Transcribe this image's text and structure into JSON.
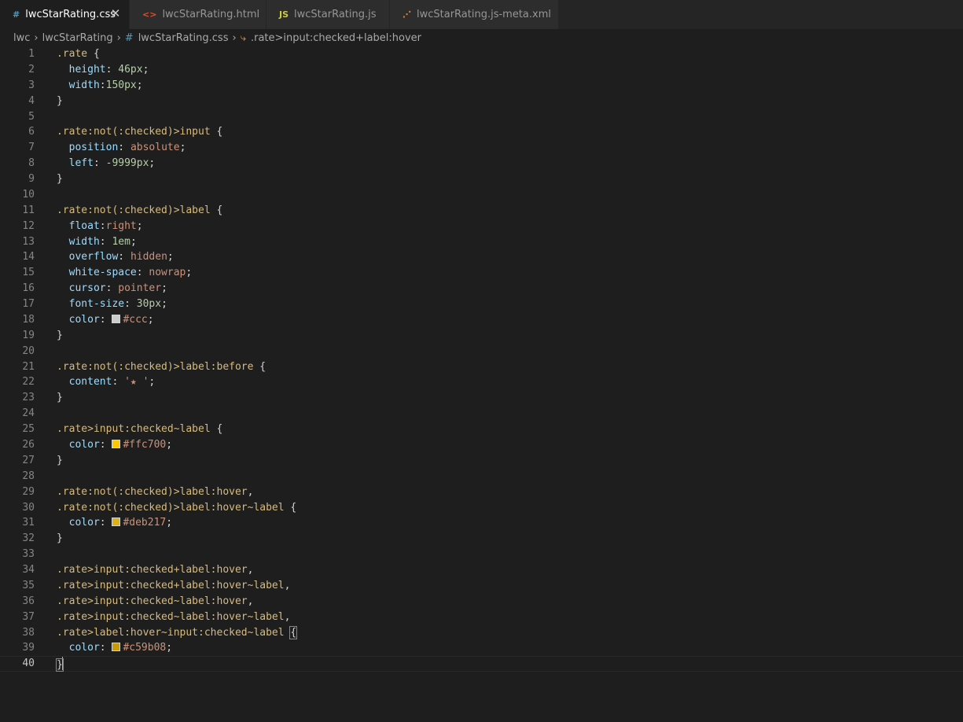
{
  "colors": {
    "selector": "#d7ba7d",
    "property": "#9cdcfe",
    "value": "#ce9178",
    "number": "#b5cea8",
    "punct": "#d4d4d4"
  },
  "tabs": [
    {
      "label": "lwcStarRating.css",
      "icon": "css-hash-icon",
      "glyph": "#",
      "color": "#519aba",
      "active": true,
      "close": "✕"
    },
    {
      "label": "lwcStarRating.html",
      "icon": "html-brackets-icon",
      "glyph": "<>",
      "color": "#e44d26",
      "active": false
    },
    {
      "label": "lwcStarRating.js",
      "icon": "js-icon",
      "glyph": "JS",
      "color": "#cbcb41",
      "active": false
    },
    {
      "label": "lwcStarRating.js-meta.xml",
      "icon": "xml-rss-icon",
      "glyph": "⋰",
      "color": "#e37933",
      "active": false
    }
  ],
  "breadcrumb": {
    "items": [
      "lwc",
      "lwcStarRating",
      "lwcStarRating.css",
      ".rate>input:checked+label:hover"
    ],
    "icons": [
      "",
      "",
      "css-hash-icon",
      "selector-symbol-icon"
    ],
    "glyphs": [
      "",
      "",
      "#",
      "⤷"
    ],
    "separator": "›"
  },
  "editor": {
    "current_line": 40,
    "lines": [
      [
        [
          ".rate",
          "s"
        ],
        [
          " {",
          "p"
        ]
      ],
      [
        [
          "  height",
          "k"
        ],
        [
          ": ",
          "p"
        ],
        [
          "46px",
          "n"
        ],
        [
          ";",
          "p"
        ]
      ],
      [
        [
          "  width",
          "k"
        ],
        [
          ":",
          "p"
        ],
        [
          "150px",
          "n"
        ],
        [
          ";",
          "p"
        ]
      ],
      [
        [
          "}",
          "p"
        ]
      ],
      [],
      [
        [
          ".rate:not(:checked)>input",
          "s"
        ],
        [
          " {",
          "p"
        ]
      ],
      [
        [
          "  position",
          "k"
        ],
        [
          ": ",
          "p"
        ],
        [
          "absolute",
          "v"
        ],
        [
          ";",
          "p"
        ]
      ],
      [
        [
          "  left",
          "k"
        ],
        [
          ": ",
          "p"
        ],
        [
          "-9999px",
          "n"
        ],
        [
          ";",
          "p"
        ]
      ],
      [
        [
          "}",
          "p"
        ]
      ],
      [],
      [
        [
          ".rate:not(:checked)>label",
          "s"
        ],
        [
          " {",
          "p"
        ]
      ],
      [
        [
          "  float",
          "k"
        ],
        [
          ":",
          "p"
        ],
        [
          "right",
          "v"
        ],
        [
          ";",
          "p"
        ]
      ],
      [
        [
          "  width",
          "k"
        ],
        [
          ": ",
          "p"
        ],
        [
          "1em",
          "n"
        ],
        [
          ";",
          "p"
        ]
      ],
      [
        [
          "  overflow",
          "k"
        ],
        [
          ": ",
          "p"
        ],
        [
          "hidden",
          "v"
        ],
        [
          ";",
          "p"
        ]
      ],
      [
        [
          "  white-space",
          "k"
        ],
        [
          ": ",
          "p"
        ],
        [
          "nowrap",
          "v"
        ],
        [
          ";",
          "p"
        ]
      ],
      [
        [
          "  cursor",
          "k"
        ],
        [
          ": ",
          "p"
        ],
        [
          "pointer",
          "v"
        ],
        [
          ";",
          "p"
        ]
      ],
      [
        [
          "  font-size",
          "k"
        ],
        [
          ": ",
          "p"
        ],
        [
          "30px",
          "n"
        ],
        [
          ";",
          "p"
        ]
      ],
      [
        [
          "  color",
          "k"
        ],
        [
          ": ",
          "p"
        ],
        [
          "#cccccc",
          "sw"
        ],
        [
          "#ccc",
          "v"
        ],
        [
          ";",
          "p"
        ]
      ],
      [
        [
          "}",
          "p"
        ]
      ],
      [],
      [
        [
          ".rate:not(:checked)>label:before",
          "s"
        ],
        [
          " {",
          "p"
        ]
      ],
      [
        [
          "  content",
          "k"
        ],
        [
          ": ",
          "p"
        ],
        [
          "'★ '",
          "v"
        ],
        [
          ";",
          "p"
        ]
      ],
      [
        [
          "}",
          "p"
        ]
      ],
      [],
      [
        [
          ".rate>input:checked~label",
          "s"
        ],
        [
          " {",
          "p"
        ]
      ],
      [
        [
          "  color",
          "k"
        ],
        [
          ": ",
          "p"
        ],
        [
          "#ffc700",
          "sw"
        ],
        [
          "#ffc700",
          "v"
        ],
        [
          ";",
          "p"
        ]
      ],
      [
        [
          "}",
          "p"
        ]
      ],
      [],
      [
        [
          ".rate:not(:checked)>label:hover",
          "s"
        ],
        [
          ",",
          "p"
        ]
      ],
      [
        [
          ".rate:not(:checked)>label:hover~label",
          "s"
        ],
        [
          " {",
          "p"
        ]
      ],
      [
        [
          "  color",
          "k"
        ],
        [
          ": ",
          "p"
        ],
        [
          "#deb217",
          "sw"
        ],
        [
          "#deb217",
          "v"
        ],
        [
          ";",
          "p"
        ]
      ],
      [
        [
          "}",
          "p"
        ]
      ],
      [],
      [
        [
          ".rate>input:checked+label:hover",
          "s"
        ],
        [
          ",",
          "p"
        ]
      ],
      [
        [
          ".rate>input:checked+label:hover~label",
          "s"
        ],
        [
          ",",
          "p"
        ]
      ],
      [
        [
          ".rate>input:checked~label:hover",
          "s"
        ],
        [
          ",",
          "p"
        ]
      ],
      [
        [
          ".rate>input:checked~label:hover~label",
          "s"
        ],
        [
          ",",
          "p"
        ]
      ],
      [
        [
          ".rate>label:hover~input:checked~label",
          "s"
        ],
        [
          " ",
          "p"
        ],
        [
          "{",
          "bp"
        ]
      ],
      [
        [
          "  color",
          "k"
        ],
        [
          ": ",
          "p"
        ],
        [
          "#c59b08",
          "sw"
        ],
        [
          "#c59b08",
          "v"
        ],
        [
          ";",
          "p"
        ]
      ],
      [
        [
          "}",
          "bpc"
        ]
      ]
    ]
  }
}
